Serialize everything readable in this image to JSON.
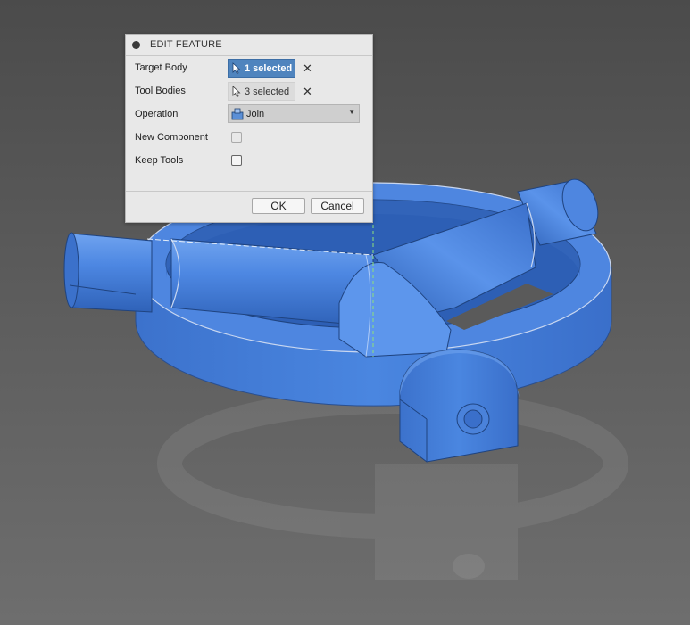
{
  "dialog": {
    "title": "EDIT FEATURE",
    "target_body": {
      "label": "Target Body",
      "value": "1 selected"
    },
    "tool_bodies": {
      "label": "Tool Bodies",
      "value": "3 selected"
    },
    "operation": {
      "label": "Operation",
      "value": "Join"
    },
    "new_component": {
      "label": "New Component",
      "checked": false
    },
    "keep_tools": {
      "label": "Keep Tools",
      "checked": false
    },
    "clear_glyph": "✕",
    "ok_label": "OK",
    "cancel_label": "Cancel"
  },
  "colors": {
    "model": "#3f78d8",
    "background": "#4a4a4a",
    "selection": "#4f84be"
  }
}
